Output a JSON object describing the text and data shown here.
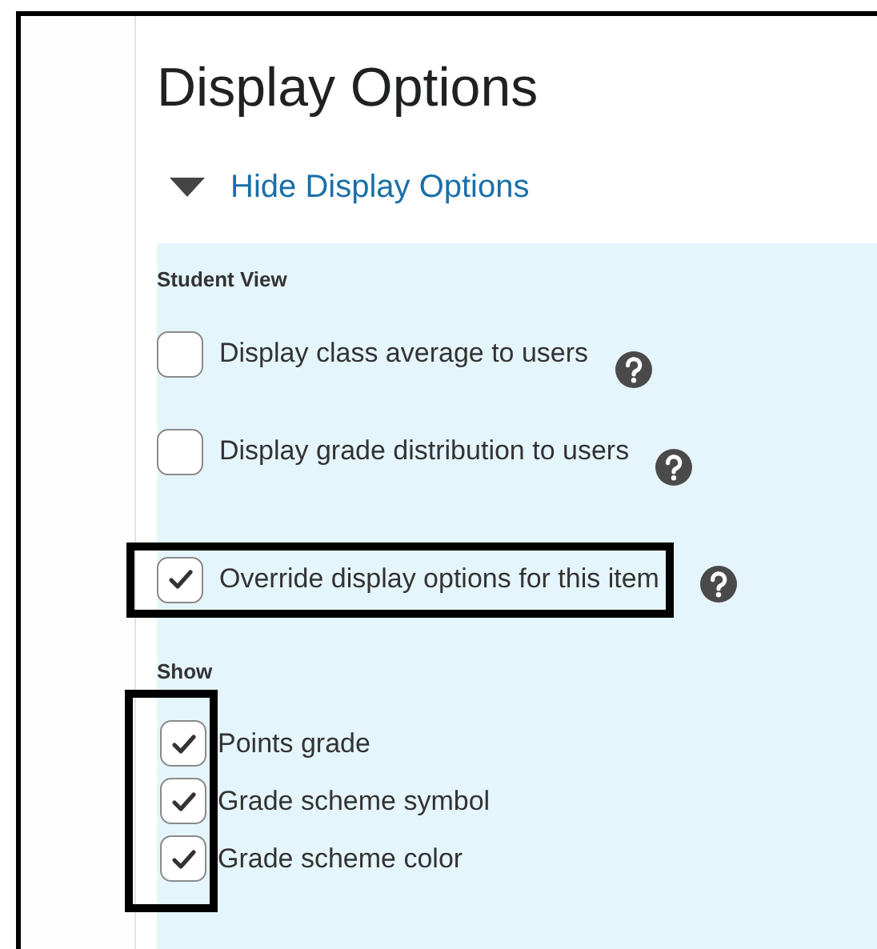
{
  "title": "Display Options",
  "toggle": {
    "label": "Hide Display Options",
    "expanded": true
  },
  "student_view": {
    "heading": "Student View",
    "options": [
      {
        "label": "Display class average to users",
        "checked": false,
        "highlighted": false
      },
      {
        "label": "Display grade distribution to users",
        "checked": false,
        "highlighted": false
      },
      {
        "label": "Override display options for this item",
        "checked": true,
        "highlighted": true
      }
    ]
  },
  "show": {
    "heading": "Show",
    "highlighted": true,
    "options": [
      {
        "label": "Points grade",
        "checked": true
      },
      {
        "label": "Grade scheme symbol",
        "checked": true
      },
      {
        "label": "Grade scheme color",
        "checked": true
      }
    ]
  }
}
